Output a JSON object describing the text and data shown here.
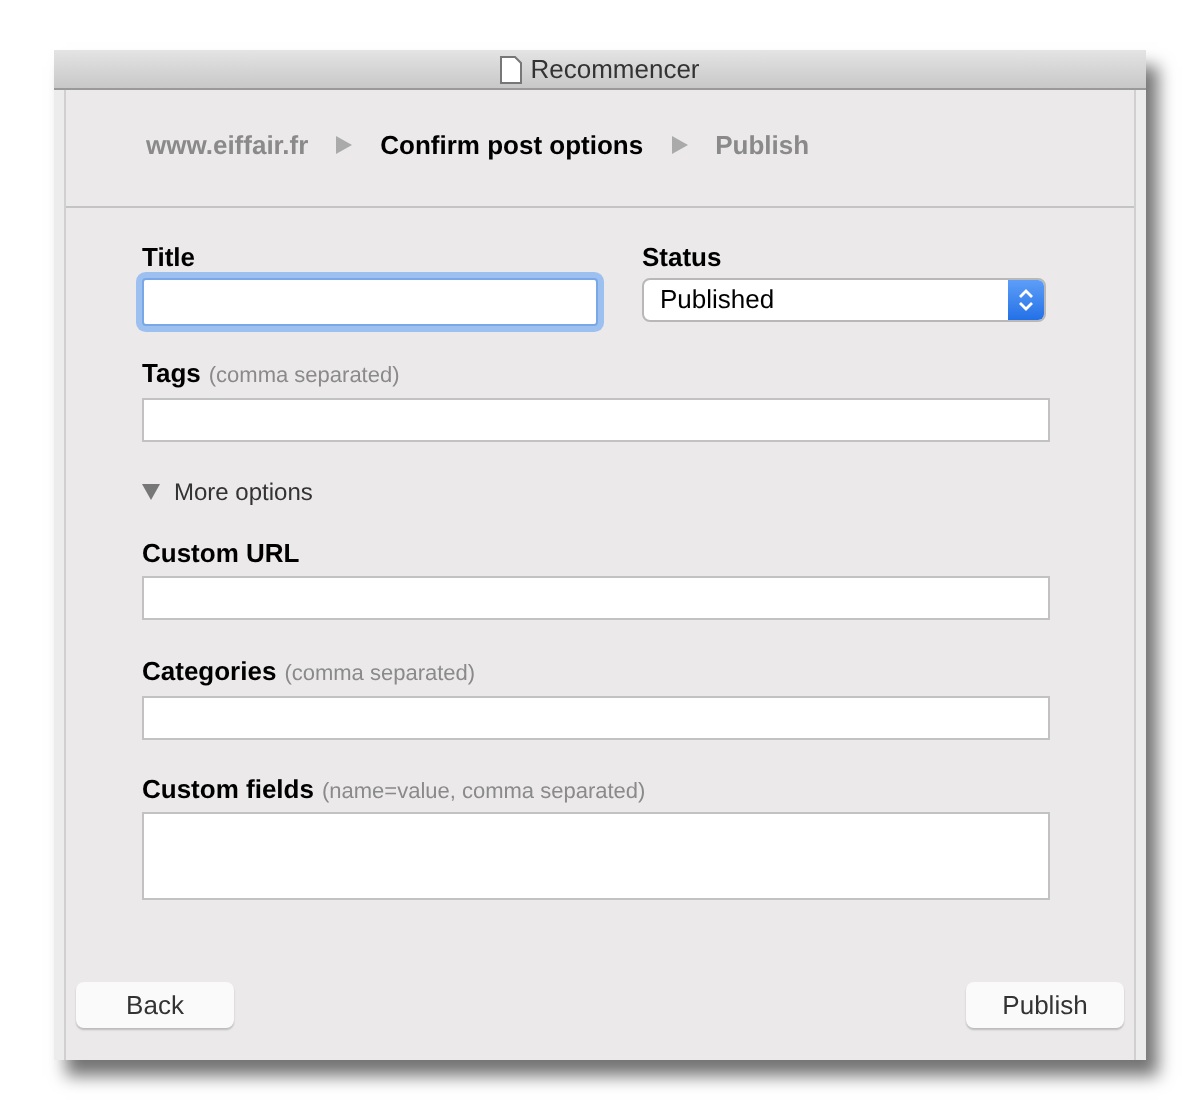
{
  "window": {
    "title": "Recommencer"
  },
  "breadcrumb": [
    {
      "label": "www.eiffair.fr",
      "selected": false
    },
    {
      "label": "Confirm post options",
      "selected": true
    },
    {
      "label": "Publish",
      "selected": false
    }
  ],
  "title_field": {
    "label": "Title",
    "focused": true
  },
  "status": {
    "label": "Status",
    "value": "Published"
  },
  "tags": {
    "label": "Tags",
    "hint": "(comma separated)"
  },
  "more_options": {
    "label": "More options",
    "expanded": true
  },
  "custom_url": {
    "label": "Custom URL"
  },
  "categories": {
    "label": "Categories",
    "hint": "(comma separated)"
  },
  "custom_fields": {
    "label": "Custom fields",
    "hint": "(name=value, comma separated)"
  },
  "buttons": [
    "Back",
    "Publish"
  ]
}
